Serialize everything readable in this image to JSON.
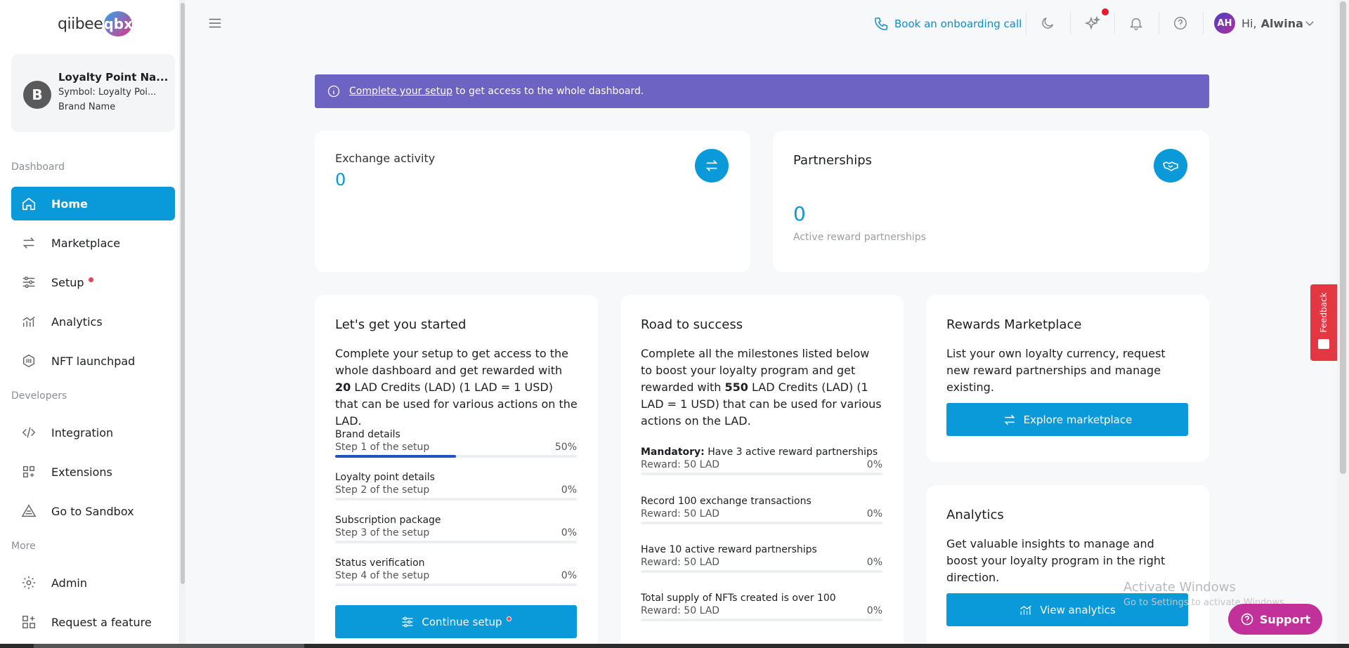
{
  "logo": {
    "text": "qiibee",
    "mark": "qbx"
  },
  "brand": {
    "initial": "B",
    "name": "Loyalty Point Na...",
    "symbol": "Symbol: Loyalty Poi...",
    "sub": "Brand Name"
  },
  "sidebar": {
    "sections": [
      "Dashboard",
      "Developers",
      "More"
    ],
    "items": [
      {
        "label": "Home",
        "icon": "home-icon"
      },
      {
        "label": "Marketplace",
        "icon": "swap-icon"
      },
      {
        "label": "Setup",
        "icon": "sliders-icon"
      },
      {
        "label": "Analytics",
        "icon": "chart-icon"
      },
      {
        "label": "NFT launchpad",
        "icon": "nft-icon"
      },
      {
        "label": "Integration",
        "icon": "code-icon"
      },
      {
        "label": "Extensions",
        "icon": "grid-plus-icon"
      },
      {
        "label": "Go to Sandbox",
        "icon": "sandbox-icon"
      },
      {
        "label": "Admin",
        "icon": "gear-icon"
      },
      {
        "label": "Request a feature",
        "icon": "feature-icon"
      }
    ]
  },
  "header": {
    "onboarding": "Book an onboarding call",
    "user_initials": "AH",
    "greeting": "Hi,",
    "user_name": "Alwina"
  },
  "banner": {
    "link": "Complete your setup",
    "text": " to get access to the whole dashboard."
  },
  "exchange": {
    "title": "Exchange activity",
    "value": "0"
  },
  "partnerships": {
    "title": "Partnerships",
    "value": "0",
    "caption": "Active reward partnerships"
  },
  "started": {
    "title": "Let's get you started",
    "text_pre": "Complete your setup to get access to the whole dashboard and get rewarded with ",
    "text_bold": "20",
    "text_post": " LAD Credits (LAD) (1 LAD = 1 USD) that can be used for various actions on the LAD.",
    "steps": [
      {
        "title": "Brand details",
        "sub": "Step 1 of the setup",
        "pct_label": "50%",
        "progress": 0.5
      },
      {
        "title": "Loyalty point details",
        "sub": "Step 2 of the setup",
        "pct_label": "0%",
        "progress": 0
      },
      {
        "title": "Subscription package",
        "sub": "Step 3 of the setup",
        "pct_label": "0%",
        "progress": 0
      },
      {
        "title": "Status verification",
        "sub": "Step 4 of the setup",
        "pct_label": "0%",
        "progress": 0
      }
    ],
    "button": "Continue setup"
  },
  "road": {
    "title": "Road to success",
    "text_pre": "Complete all the milestones listed below to boost your loyalty program and get rewarded with ",
    "text_bold": "550",
    "text_post": " LAD Credits (LAD) (1 LAD = 1 USD) that can be used for various actions on the LAD.",
    "milestones": [
      {
        "bold": "Mandatory:",
        "title": " Have 3 active reward partnerships",
        "reward": "Reward: 50 LAD",
        "pct_label": "0%",
        "progress": 0
      },
      {
        "bold": "",
        "title": "Record 100 exchange transactions",
        "reward": "Reward: 50 LAD",
        "pct_label": "0%",
        "progress": 0
      },
      {
        "bold": "",
        "title": "Have 10 active reward partnerships",
        "reward": "Reward: 50 LAD",
        "pct_label": "0%",
        "progress": 0
      },
      {
        "bold": "",
        "title": "Total supply of NFTs created is over 100",
        "reward": "Reward: 50 LAD",
        "pct_label": "0%",
        "progress": 0
      }
    ]
  },
  "rewards": {
    "title": "Rewards Marketplace",
    "text": "List your own loyalty currency, request new reward partnerships and manage existing.",
    "button": "Explore marketplace"
  },
  "analytics": {
    "title": "Analytics",
    "text": "Get valuable insights to manage and boost your loyalty program in the right direction.",
    "button": "View analytics"
  },
  "feedback": "Feedback",
  "support": "Support",
  "watermark": {
    "title": "Activate Windows",
    "sub": "Go to Settings to activate Windows."
  },
  "colors": {
    "accent": "#0a99d9",
    "banner": "#6d63c3",
    "progress": "#1f56c4",
    "alert": "#e8455d",
    "support": "#c2309a"
  }
}
